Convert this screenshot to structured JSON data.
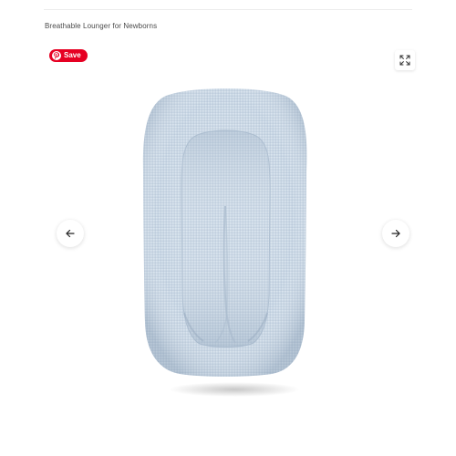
{
  "product": {
    "subtitle": "Breathable Lounger for Newborns"
  },
  "pinterest": {
    "save_label": "Save",
    "brand_color": "#e60023"
  },
  "controls": {
    "expand_icon": "expand-icon",
    "prev_icon": "arrow-left-icon",
    "next_icon": "arrow-right-icon"
  },
  "image": {
    "subject": "baby-lounger",
    "primary_color": "#c7d5e3"
  }
}
